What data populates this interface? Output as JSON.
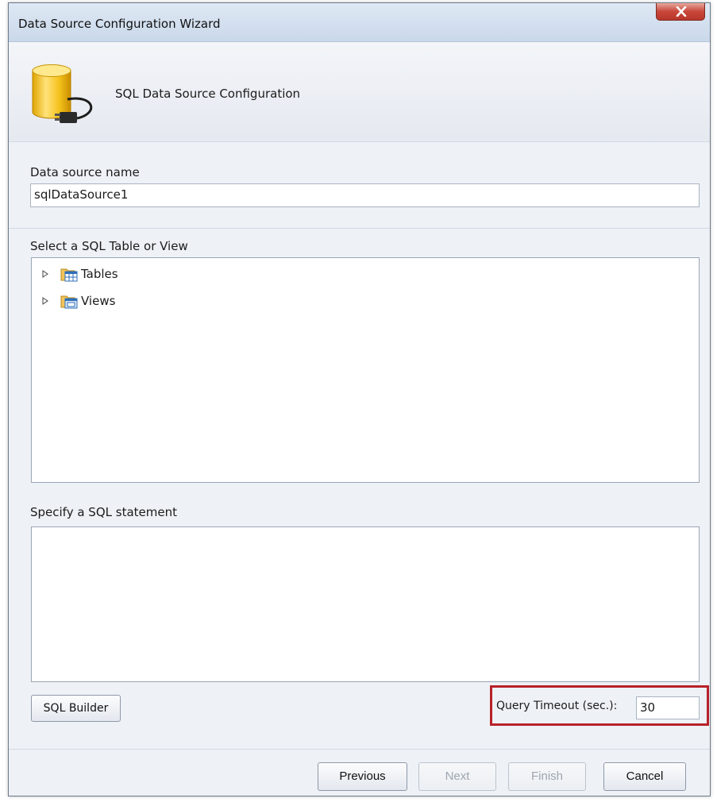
{
  "window": {
    "title": "Data Source Configuration Wizard"
  },
  "header": {
    "title": "SQL Data Source Configuration",
    "icon": "database-plug-icon"
  },
  "data_source": {
    "label": "Data source name",
    "value": "sqlDataSource1"
  },
  "table_select": {
    "label": "Select a SQL Table or View",
    "items": [
      {
        "label": "Tables",
        "icon": "table-folder-icon"
      },
      {
        "label": "Views",
        "icon": "view-folder-icon"
      }
    ]
  },
  "sql_statement": {
    "label": "Specify a SQL statement",
    "value": ""
  },
  "sql_builder": {
    "label": "SQL Builder"
  },
  "query_timeout": {
    "label": "Query Timeout (sec.):",
    "value": "30",
    "highlight_color": "#b8212a"
  },
  "footer": {
    "previous_label": "Previous",
    "next_label": "Next",
    "finish_label": "Finish",
    "cancel_label": "Cancel"
  }
}
